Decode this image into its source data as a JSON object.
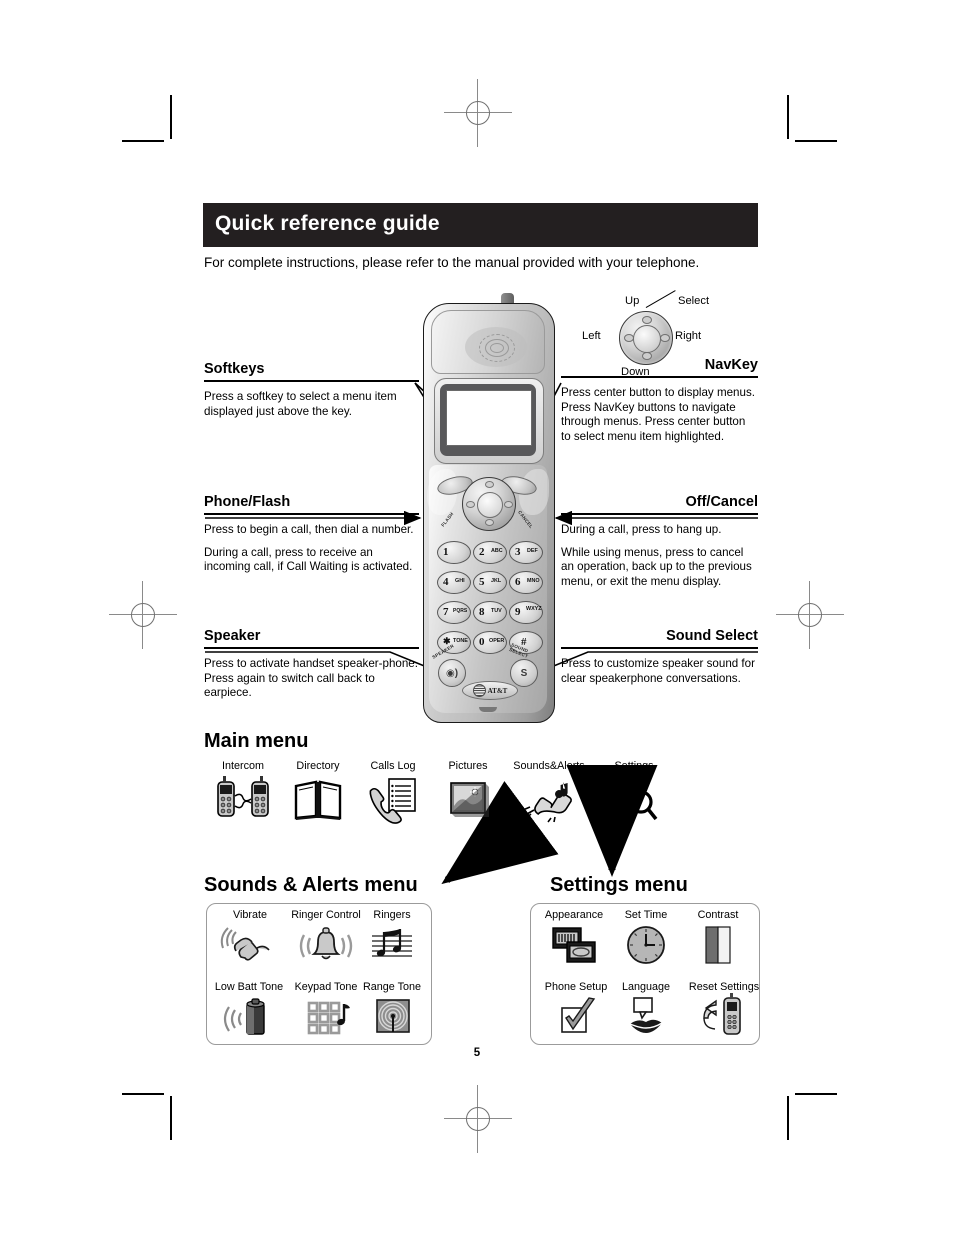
{
  "page": {
    "number": "5",
    "title": "Quick reference guide",
    "subtitle": "For complete instructions, please refer to the manual provided with your telephone."
  },
  "navkey_legend": {
    "up": "Up",
    "down": "Down",
    "left": "Left",
    "right": "Right",
    "select": "Select"
  },
  "callouts": {
    "softkeys": {
      "heading": "Softkeys",
      "body": "Press a softkey to select a menu item displayed just above the key."
    },
    "navkey": {
      "heading": "NavKey",
      "body": "Press center button to display menus. Press NavKey buttons to navigate through menus. Press center button to select menu item highlighted."
    },
    "phone_flash": {
      "heading": "Phone/Flash",
      "body1": "Press to begin a call, then dial a number.",
      "body2": "During a call, press to receive an incoming call, if Call Waiting is activated."
    },
    "off_cancel": {
      "heading": "Off/Cancel",
      "body1": "During a call, press to hang up.",
      "body2": "While using menus, press to cancel an operation, back up to the previous menu, or exit the menu display."
    },
    "speaker": {
      "heading": "Speaker",
      "body": "Press to activate handset speaker-phone. Press again to switch call back to earpiece."
    },
    "sound_select": {
      "heading": "Sound Select",
      "body": "Press to customize speaker sound for clear speakerphone conversations."
    }
  },
  "phone": {
    "brand": "AT&T",
    "keys": [
      {
        "digit": "1",
        "letters": ""
      },
      {
        "digit": "2",
        "letters": "ABC"
      },
      {
        "digit": "3",
        "letters": "DEF"
      },
      {
        "digit": "4",
        "letters": "GHI"
      },
      {
        "digit": "5",
        "letters": "JKL"
      },
      {
        "digit": "6",
        "letters": "MNO"
      },
      {
        "digit": "7",
        "letters": "PQRS"
      },
      {
        "digit": "8",
        "letters": "TUV"
      },
      {
        "digit": "9",
        "letters": "WXYZ"
      },
      {
        "digit": "✱",
        "letters": "TONE"
      },
      {
        "digit": "0",
        "letters": "OPER"
      },
      {
        "digit": "#",
        "letters": ""
      }
    ],
    "speaker_key_label": "SPEAKER",
    "sound_key_label": "SOUND SELECT",
    "sound_key_glyph": "S",
    "flash_label": "FLASH",
    "cancel_label": "CANCEL"
  },
  "main_menu": {
    "title": "Main menu",
    "items": [
      {
        "label": "Intercom",
        "icon": "intercom-icon"
      },
      {
        "label": "Directory",
        "icon": "directory-book-icon"
      },
      {
        "label": "Calls Log",
        "icon": "calls-log-icon"
      },
      {
        "label": "Pictures",
        "icon": "pictures-icon"
      },
      {
        "label": "Sounds&Alerts",
        "icon": "sounds-alerts-icon"
      },
      {
        "label": "Settings",
        "icon": "settings-wrench-icon"
      }
    ]
  },
  "sounds_alerts_menu": {
    "title": "Sounds & Alerts menu",
    "items": [
      {
        "label": "Vibrate",
        "icon": "vibrate-handset-icon"
      },
      {
        "label": "Ringer Control",
        "icon": "bell-icon"
      },
      {
        "label": "Ringers",
        "icon": "music-notes-icon"
      },
      {
        "label": "Low Batt Tone",
        "icon": "battery-icon"
      },
      {
        "label": "Keypad Tone",
        "icon": "keypad-note-icon"
      },
      {
        "label": "Range Tone",
        "icon": "range-radar-icon"
      }
    ]
  },
  "settings_menu": {
    "title": "Settings menu",
    "items": [
      {
        "label": "Appearance",
        "icon": "windows-icon"
      },
      {
        "label": "Set Time",
        "icon": "clock-icon"
      },
      {
        "label": "Contrast",
        "icon": "contrast-icon"
      },
      {
        "label": "Phone Setup",
        "icon": "checkbox-check-icon"
      },
      {
        "label": "Language",
        "icon": "lips-speech-icon"
      },
      {
        "label": "Reset Settings",
        "icon": "reset-handset-icon"
      }
    ]
  },
  "colors": {
    "title_bar": "#231f20",
    "rule": "#000000",
    "menu_box_border": "#9b9b9b"
  }
}
